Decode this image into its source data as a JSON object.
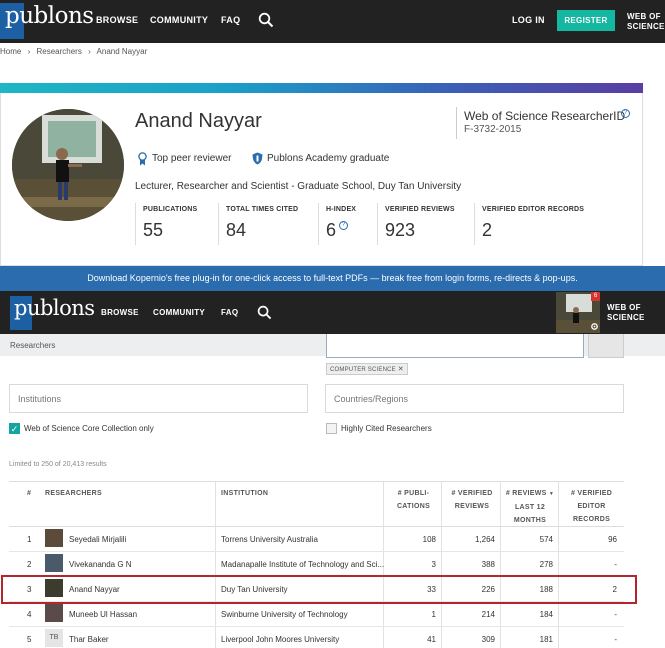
{
  "nav": {
    "logo": "publons",
    "browse": "BROWSE",
    "community": "COMMUNITY",
    "faq": "FAQ",
    "login": "LOG IN",
    "register": "REGISTER",
    "wos_line1": "WEB OF",
    "wos_line2": "SCIENCE"
  },
  "breadcrumb": [
    "Home",
    "Researchers",
    "Anand Nayyar"
  ],
  "profile": {
    "name": "Anand Nayyar",
    "badge1": "Top peer reviewer",
    "badge2": "Publons Academy graduate",
    "role": "Lecturer, Researcher and Scientist - Graduate School, Duy Tan University",
    "researcher_id_title": "Web of Science ResearcherID",
    "researcher_id": "F-3732-2015",
    "stats": [
      {
        "label": "PUBLICATIONS",
        "value": "55"
      },
      {
        "label": "TOTAL TIMES CITED",
        "value": "84"
      },
      {
        "label": "H-INDEX",
        "value": "6"
      },
      {
        "label": "VERIFIED REVIEWS",
        "value": "923"
      },
      {
        "label": "VERIFIED EDITOR RECORDS",
        "value": "2"
      }
    ],
    "colors": {
      "accent_start": "#1fb6c5",
      "accent_end": "#5a3ea2"
    }
  },
  "banner": "Download Kopernio's free plug-in for one-click access to full-text PDFs — break free from login forms, re-directs & pop-ups.",
  "nav2": {
    "notifications": "6"
  },
  "search": {
    "breadcrumb": "Researchers",
    "chip": "COMPUTER SCIENCE",
    "institutions_placeholder": "Institutions",
    "countries_placeholder": "Countries/Regions",
    "core_collection": "Web of Science Core Collection only",
    "highly_cited": "Highly Cited Researchers",
    "limited": "Limited to 250 of 20,413 results"
  },
  "table": {
    "headers": {
      "rank": "#",
      "researchers": "RESEARCHERS",
      "institution": "INSTITUTION",
      "pubs_1": "# PUBLI-",
      "pubs_2": "CATIONS",
      "rev_1": "# VERIFIED",
      "rev_2": "REVIEWS",
      "last_1": "# REVIEWS",
      "last_2": "LAST 12",
      "last_3": "MONTHS",
      "ed_1": "# VERIFIED",
      "ed_2": "EDITOR",
      "ed_3": "RECORDS"
    },
    "rows": [
      {
        "rank": "1",
        "name": "Seyedali Mirjalili",
        "institution": "Torrens University Australia",
        "pubs": "108",
        "reviews": "1,264",
        "last12": "574",
        "editor": "96"
      },
      {
        "rank": "2",
        "name": "Vivekananda G N",
        "institution": "Madanapalle Institute of Technology and Sci...",
        "pubs": "3",
        "reviews": "388",
        "last12": "278",
        "editor": "-"
      },
      {
        "rank": "3",
        "name": "Anand Nayyar",
        "institution": "Duy Tan University",
        "pubs": "33",
        "reviews": "226",
        "last12": "188",
        "editor": "2"
      },
      {
        "rank": "4",
        "name": "Muneeb Ul Hassan",
        "institution": "Swinburne University of Technology",
        "pubs": "1",
        "reviews": "214",
        "last12": "184",
        "editor": "-"
      },
      {
        "rank": "5",
        "name": "Thar Baker",
        "institution": "Liverpool John Moores University",
        "pubs": "41",
        "reviews": "309",
        "last12": "181",
        "editor": "-",
        "initials": "TB"
      }
    ]
  }
}
